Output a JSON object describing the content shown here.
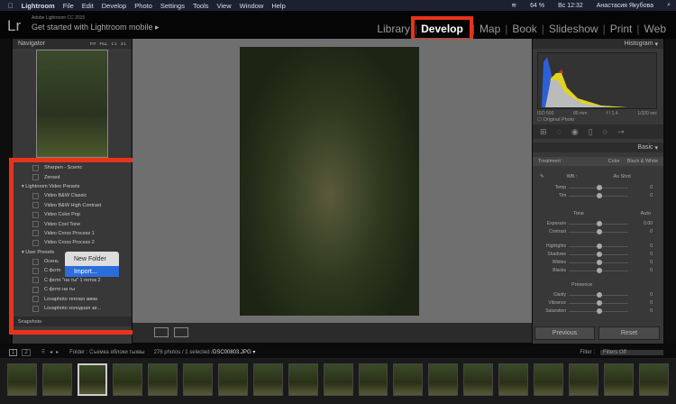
{
  "menubar": {
    "app": "Lightroom",
    "items": [
      "File",
      "Edit",
      "Develop",
      "Photo",
      "Settings",
      "Tools",
      "View",
      "Window",
      "Help"
    ],
    "battery": "64 %",
    "clock": "Вс 12:32",
    "user": "Анастасия Якубова"
  },
  "header": {
    "logo": "Lr",
    "version": "Adobe Lightroom CC 2015",
    "mobile": "Get started with Lightroom mobile ▸",
    "modules": [
      "Library",
      "Develop",
      "Map",
      "Book",
      "Slideshow",
      "Print",
      "Web"
    ],
    "active_module": "Develop"
  },
  "left": {
    "navigator": "Navigator",
    "nav_zoom": [
      "FIT",
      "FILL",
      "1:1",
      "3:1"
    ],
    "presets": [
      {
        "type": "it",
        "label": "Sharpen - Scenic"
      },
      {
        "type": "it",
        "label": "Zeroed"
      },
      {
        "type": "grp",
        "label": "▾ Lightroom Video Presets"
      },
      {
        "type": "it",
        "label": "Video B&W Classic"
      },
      {
        "type": "it",
        "label": "Video B&W High Contrast"
      },
      {
        "type": "it",
        "label": "Video Color Pop"
      },
      {
        "type": "it",
        "label": "Video Cool Tone"
      },
      {
        "type": "it",
        "label": "Video Cross Process 1"
      },
      {
        "type": "it",
        "label": "Video Cross Process 2"
      },
      {
        "type": "grp",
        "label": "▾ User Presets"
      },
      {
        "type": "it",
        "label": "Осень"
      },
      {
        "type": "it",
        "label": "С фото"
      },
      {
        "type": "it",
        "label": "С фото \"на ты\" 1 поток 2"
      },
      {
        "type": "it",
        "label": "С фото на ты"
      },
      {
        "type": "it",
        "label": "Lovaphoto теплая зима"
      },
      {
        "type": "it",
        "label": "Lovaphoto холодная зи..."
      }
    ],
    "snapshots": "Snapshots",
    "context_menu": [
      "New Folder",
      "Import..."
    ]
  },
  "right": {
    "histogram": "Histogram",
    "info": [
      "ISO 500",
      "85 mm",
      "f / 1.4",
      "1/320 sec"
    ],
    "original_photo": "Original Photo",
    "basic": "Basic",
    "treatment": "Treatment :",
    "color": "Color",
    "bw": "Black & White",
    "wb": "WB :",
    "wb_value": "As Shot",
    "tone": "Tone",
    "auto": "Auto",
    "presence": "Presence",
    "sliders": [
      {
        "label": "Temp",
        "value": "0"
      },
      {
        "label": "Tint",
        "value": "0"
      },
      {
        "label": "Exposure",
        "value": "0.00"
      },
      {
        "label": "Contrast",
        "value": "0"
      },
      {
        "label": "Highlights",
        "value": "0"
      },
      {
        "label": "Shadows",
        "value": "0"
      },
      {
        "label": "Whites",
        "value": "0"
      },
      {
        "label": "Blacks",
        "value": "0"
      },
      {
        "label": "Clarity",
        "value": "0"
      },
      {
        "label": "Vibrance",
        "value": "0"
      },
      {
        "label": "Saturation",
        "value": "0"
      }
    ],
    "previous": "Previous",
    "reset": "Reset"
  },
  "infobar": {
    "pages": [
      "1",
      "2"
    ],
    "folder": "Folder : Съемка яблоки тыквы",
    "count": "276 photos / 1 selected /",
    "file": "DSC00803.JPG ▾",
    "filter_label": "Filter :",
    "filter_value": "Filters Off"
  },
  "colors": {
    "accent_red": "#e8331c",
    "menu_highlight": "#2b6ddc"
  }
}
